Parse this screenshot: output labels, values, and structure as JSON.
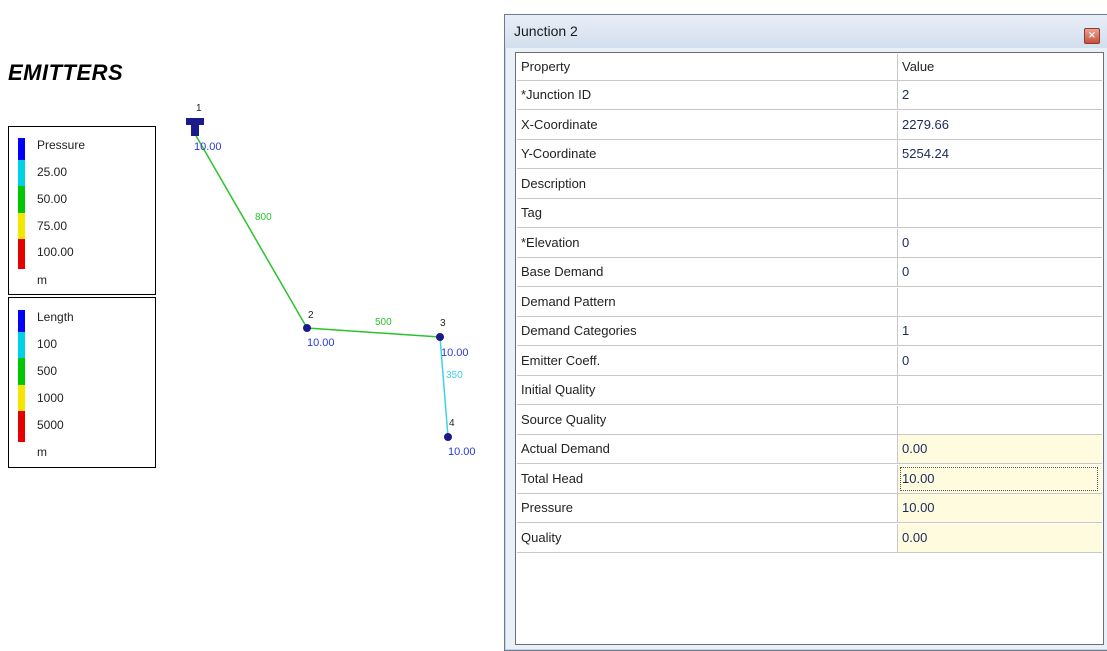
{
  "map": {
    "title": "EMITTERS",
    "pressure_legend": {
      "title": "Pressure",
      "entries": [
        "25.00",
        "50.00",
        "75.00",
        "100.00"
      ],
      "unit": "m",
      "colors": [
        "#0000ff",
        "#00d2e6",
        "#00c800",
        "#f5e600",
        "#e60000"
      ]
    },
    "length_legend": {
      "title": "Length",
      "entries": [
        "100",
        "500",
        "1000",
        "5000"
      ],
      "unit": "m",
      "colors": [
        "#0000ff",
        "#00d2e6",
        "#00c800",
        "#f5e600",
        "#e60000"
      ]
    },
    "nodes": [
      {
        "id": "1",
        "value": "10.00",
        "type": "reservoir"
      },
      {
        "id": "2",
        "value": "10.00",
        "type": "junction"
      },
      {
        "id": "3",
        "value": "10.00",
        "type": "junction"
      },
      {
        "id": "4",
        "value": "10.00",
        "type": "junction"
      }
    ],
    "links": [
      {
        "from": "1",
        "to": "2",
        "length": "800",
        "color": "#2ac32a"
      },
      {
        "from": "2",
        "to": "3",
        "length": "500",
        "color": "#2ac32a"
      },
      {
        "from": "3",
        "to": "4",
        "length": "350",
        "color": "#3cd2e6"
      }
    ],
    "node_label_color": "#2a3ad2",
    "node_color": "#1a1a8a"
  },
  "dialog": {
    "title": "Junction 2",
    "close_icon": "close-icon",
    "columns": {
      "property": "Property",
      "value": "Value"
    },
    "rows": [
      {
        "property": "*Junction ID",
        "value": "2",
        "readonly": false
      },
      {
        "property": "X-Coordinate",
        "value": "2279.66",
        "readonly": false
      },
      {
        "property": "Y-Coordinate",
        "value": "5254.24",
        "readonly": false
      },
      {
        "property": "Description",
        "value": "",
        "readonly": false
      },
      {
        "property": "Tag",
        "value": "",
        "readonly": false
      },
      {
        "property": "*Elevation",
        "value": "0",
        "readonly": false
      },
      {
        "property": "Base Demand",
        "value": "0",
        "readonly": false
      },
      {
        "property": "Demand Pattern",
        "value": "",
        "readonly": false
      },
      {
        "property": "Demand Categories",
        "value": "1",
        "readonly": false
      },
      {
        "property": "Emitter Coeff.",
        "value": "0",
        "readonly": false
      },
      {
        "property": "Initial Quality",
        "value": "",
        "readonly": false
      },
      {
        "property": "Source Quality",
        "value": "",
        "readonly": false
      },
      {
        "property": "Actual Demand",
        "value": "0.00",
        "readonly": true
      },
      {
        "property": "Total Head",
        "value": "10.00",
        "readonly": true,
        "focused": true
      },
      {
        "property": "Pressure",
        "value": "10.00",
        "readonly": true
      },
      {
        "property": "Quality",
        "value": "0.00",
        "readonly": true
      }
    ]
  }
}
